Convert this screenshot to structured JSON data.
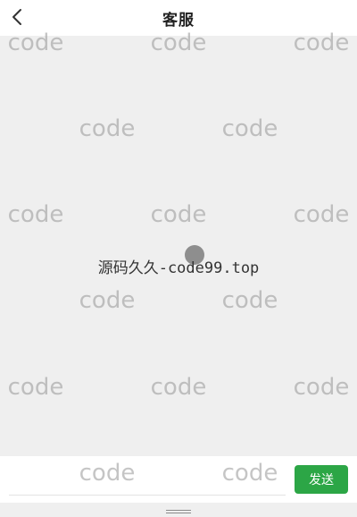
{
  "header": {
    "title": "客服",
    "back_icon": "chevron-left-icon"
  },
  "chat": {
    "notice": "源码久久-code99.top",
    "loading_indicator": "loading-spinner-icon"
  },
  "composer": {
    "input_value": "",
    "input_placeholder": "",
    "send_label": "发送"
  },
  "watermark": {
    "text": "code"
  },
  "colors": {
    "send_button": "#2ca646",
    "background": "#efefef",
    "header_bg": "#ffffff"
  }
}
